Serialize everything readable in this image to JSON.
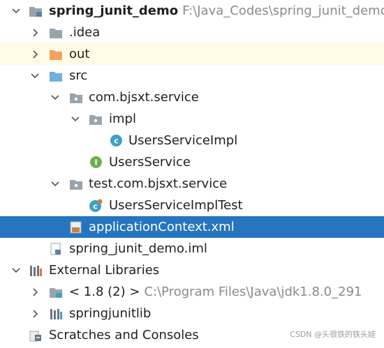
{
  "project_tree": {
    "root": {
      "name": "spring_junit_demo",
      "path": "F:\\Java_Codes\\spring_junit_demo"
    },
    "idea": {
      "name": ".idea"
    },
    "out": {
      "name": "out"
    },
    "src": {
      "name": "src"
    },
    "pkg_service": {
      "name": "com.bjsxt.service"
    },
    "pkg_impl": {
      "name": "impl"
    },
    "class_impl": {
      "name": "UsersServiceImpl"
    },
    "interface_service": {
      "name": "UsersService"
    },
    "pkg_test": {
      "name": "test.com.bjsxt.service"
    },
    "class_test": {
      "name": "UsersServiceImplTest"
    },
    "app_context": {
      "name": "applicationContext.xml"
    },
    "iml": {
      "name": "spring_junit_demo.iml"
    },
    "external_libraries": {
      "name": "External Libraries"
    },
    "jdk": {
      "name": "< 1.8 (2) >",
      "path": "C:\\Program Files\\Java\\jdk1.8.0_291"
    },
    "springjunitlib": {
      "name": "springjunitlib"
    },
    "scratches": {
      "name": "Scratches and Consoles"
    }
  },
  "watermark": "CSDN @头很铁的铁头娃",
  "colors": {
    "selection": "#2675bf",
    "highlight_row": "#fdfbe6",
    "folder_grey": "#9aa4ad",
    "folder_orange": "#f0a35a",
    "folder_blue": "#6fb1d9",
    "class_icon": "#3f9fc7",
    "interface_icon": "#6fae4f"
  },
  "icons": {
    "expanded": "chevron-down-icon",
    "collapsed": "chevron-right-icon",
    "module": "module-folder-icon",
    "folder": "folder-icon",
    "package": "package-icon",
    "class": "class-icon",
    "interface": "interface-icon",
    "test_class": "test-class-icon",
    "xml": "spring-xml-icon",
    "iml": "iml-file-icon",
    "libraries": "libraries-icon",
    "jdk": "jdk-icon",
    "library": "library-icon",
    "scratches": "scratches-icon"
  }
}
